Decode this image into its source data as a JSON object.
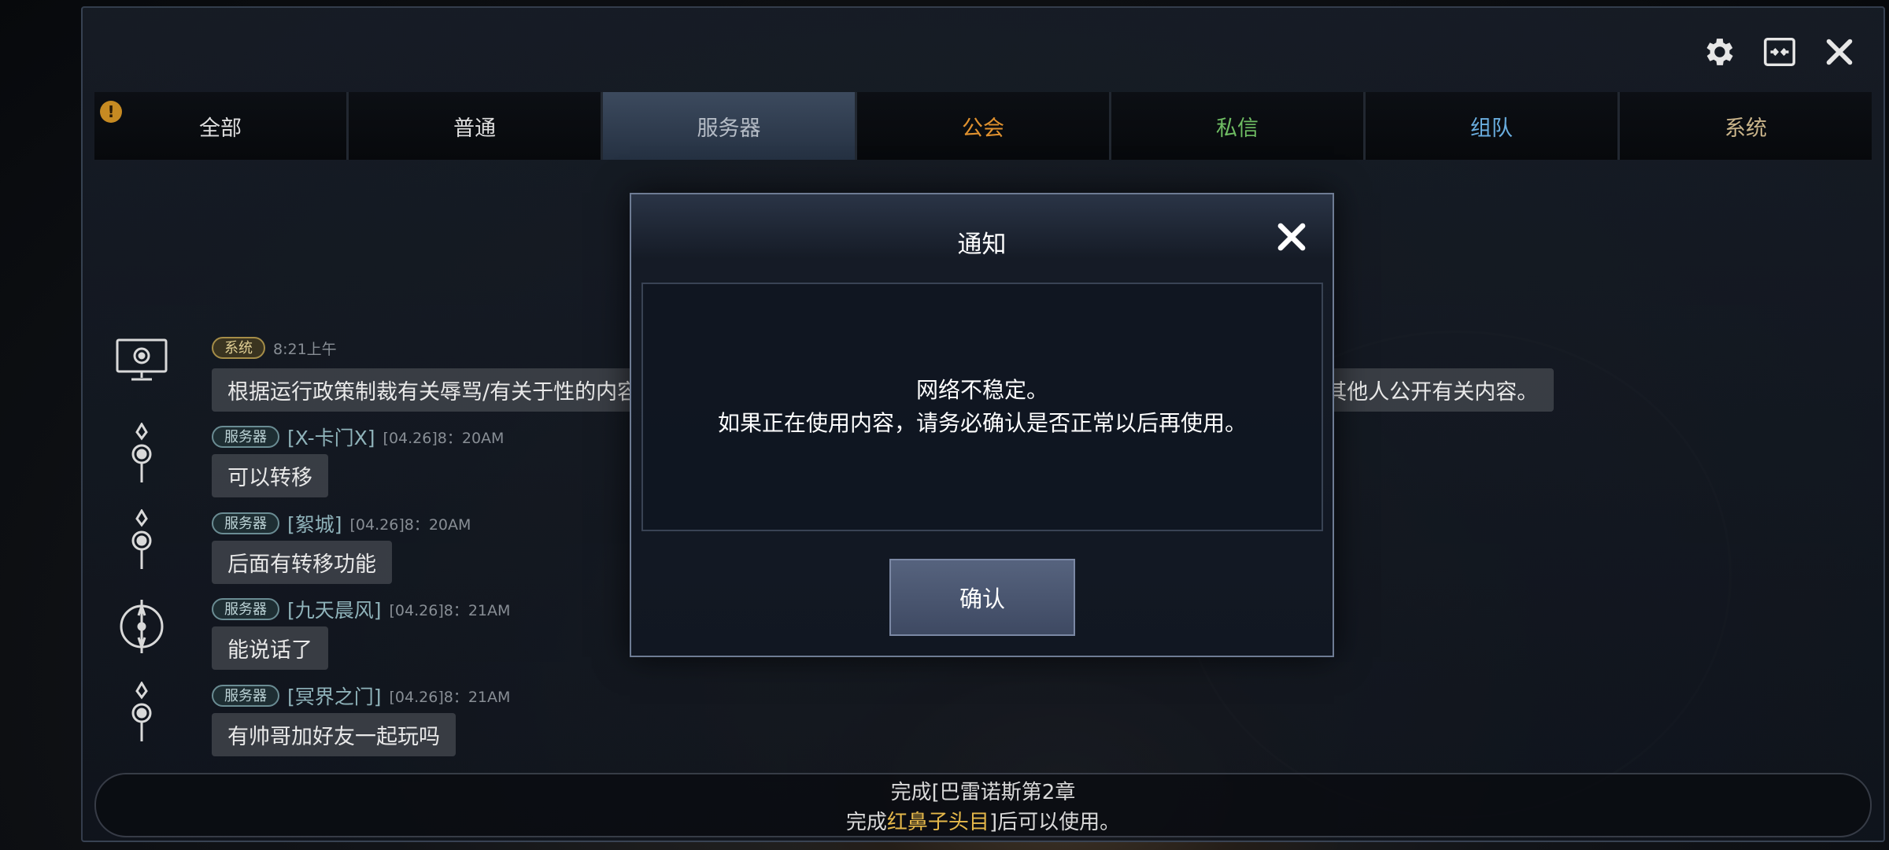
{
  "top_icons": [
    "gear-icon",
    "collapse-icon",
    "close-icon"
  ],
  "tabs": [
    {
      "label": "全部",
      "color": "#dfdfdf"
    },
    {
      "label": "普通",
      "color": "#dfdfdf"
    },
    {
      "label": "服务器",
      "color": "#b5bcc6",
      "active": true
    },
    {
      "label": "公会",
      "color": "#e0912e"
    },
    {
      "label": "私信",
      "color": "#6fbd63"
    },
    {
      "label": "组队",
      "color": "#6aaee0"
    },
    {
      "label": "系统",
      "color": "#c9b48a"
    }
  ],
  "alert_badge": "!",
  "messages": [
    {
      "badge": "系统",
      "sender": "",
      "time": "8:21上午",
      "text": "根据运行政策制裁有关辱骂/有关于性的内容/广告等不健康的聊天内容，并为了防止您的个人信息受到侵害，请不要向其他人公开有关内容。",
      "avatar": "monitor-icon"
    },
    {
      "badge": "服务器",
      "sender": "[X-卡门X]",
      "time": "[04.26]8：20AM",
      "text": "可以转移",
      "avatar": "emblem-icon"
    },
    {
      "badge": "服务器",
      "sender": "[絮城]",
      "time": "[04.26]8：20AM",
      "text": "后面有转移功能",
      "avatar": "emblem-icon"
    },
    {
      "badge": "服务器",
      "sender": "[九天晨风]",
      "time": "[04.26]8：21AM",
      "text": "能说话了",
      "avatar": "compass-icon"
    },
    {
      "badge": "服务器",
      "sender": "[冥界之门]",
      "time": "[04.26]8：21AM",
      "text": "有帅哥加好友一起玩吗",
      "avatar": "emblem-icon"
    }
  ],
  "bottom_notice": {
    "line1": "完成[巴雷诺斯第2章",
    "line2_prefix": "完成",
    "line2_highlight": "红鼻子头目",
    "line2_suffix": "]后可以使用。"
  },
  "modal": {
    "title": "通知",
    "line1": "网络不稳定。",
    "line2": "如果正在使用内容，请务必确认是否正常以后再使用。",
    "confirm_label": "确认"
  }
}
